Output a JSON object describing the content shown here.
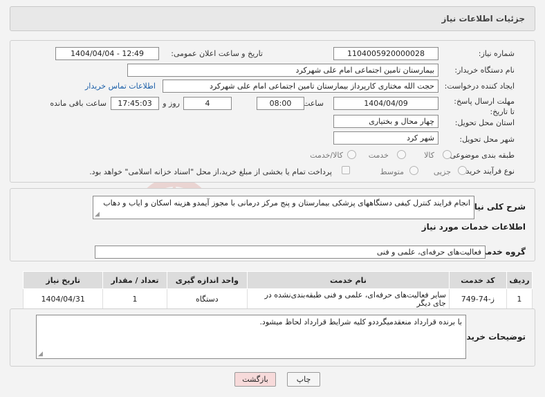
{
  "header": {
    "title": "جزئیات اطلاعات نیاز"
  },
  "form": {
    "need_number": {
      "label": "شماره نیاز:",
      "value": "1104005920000028"
    },
    "announce_datetime": {
      "label": "تاریخ و ساعت اعلان عمومی:",
      "value": "1404/04/04 - 12:49"
    },
    "buyer_org": {
      "label": "نام دستگاه خریدار:",
      "value": "بیمارستان تامین اجتماعی امام علی شهرکرد"
    },
    "requester": {
      "label": "ایجاد کننده درخواست:",
      "value": "حجت الله مختاری کارپرداز بیمارستان تامین اجتماعی امام علی شهرکرد",
      "contact_link": "اطلاعات تماس خریدار"
    },
    "deadline": {
      "label": "مهلت ارسال پاسخ: تا تاریخ:",
      "date": "1404/04/09",
      "time_label": "ساعت",
      "time": "08:00",
      "days": "4",
      "days_label": "روز و",
      "remaining_time": "17:45:03",
      "remaining_label": "ساعت باقی مانده"
    },
    "province": {
      "label": "استان محل تحویل:",
      "value": "چهار محال و بختیاری"
    },
    "city": {
      "label": "شهر محل تحویل:",
      "value": "شهر کرد"
    },
    "category": {
      "label": "طبقه بندی موضوعی:",
      "options": [
        "کالا",
        "خدمت",
        "کالا/خدمت"
      ]
    },
    "purchase_type": {
      "label": "نوع فرآیند خرید :",
      "options": [
        "جزیی",
        "متوسط"
      ],
      "note": "پرداخت تمام یا بخشی از مبلغ خرید،از محل \"اسناد خزانه اسلامی\" خواهد بود."
    }
  },
  "description": {
    "label": "شرح کلی نیاز:",
    "value": "انجام فرایند کنترل کیفی دستگاههای پزشکی بیمارستان و پنج مرکز درمانی با مجوز آیمدو هزینه اسکان و ایاب و دهاب"
  },
  "services": {
    "section_title": "اطلاعات خدمات مورد نیاز",
    "group_label": "گروه خدمت:",
    "group_value": "فعالیت‌های حرفه‌ای، علمی و فنی",
    "columns": [
      "ردیف",
      "کد خدمت",
      "نام خدمت",
      "واحد اندازه گیری",
      "تعداد / مقدار",
      "تاریخ نیاز"
    ],
    "rows": [
      {
        "index": "1",
        "code": "ز-74-749",
        "name": "سایر فعالیت‌های حرفه‌ای، علمی و فنی طبقه‌بندی‌نشده در جای دیگر",
        "unit": "دستگاه",
        "qty": "1",
        "date": "1404/04/31"
      }
    ]
  },
  "buyer_notes": {
    "label": "توضیحات خریدار:",
    "value": "با برنده قرارداد منعقدمیگرددو کلیه شرایط قرارداد لحاظ میشود."
  },
  "buttons": {
    "print": "چاپ",
    "back": "بازگشت"
  },
  "watermark": {
    "text": "AriaTender.net"
  },
  "colors": {
    "link": "#1a5ea8",
    "back_button": "#f7dada",
    "watermark": "#c0392b"
  }
}
